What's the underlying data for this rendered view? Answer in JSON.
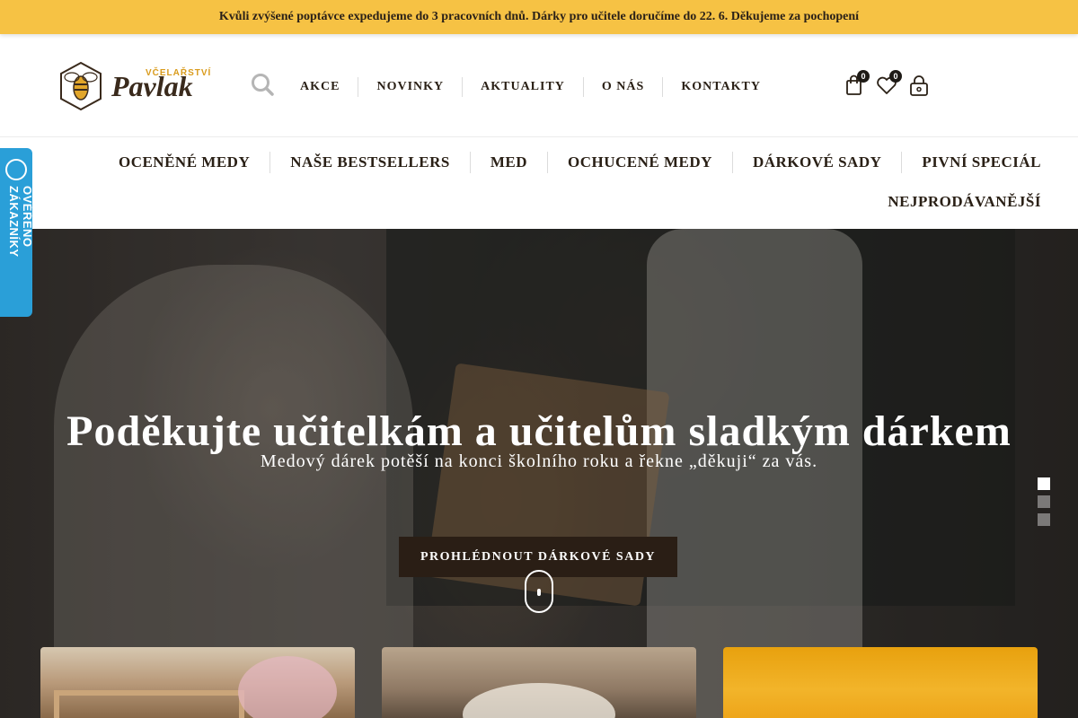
{
  "announcement": "Kvůli zvýšené poptávce expedujeme do 3 pracovních dnů. Dárky pro učitele doručíme do 22. 6. Děkujeme za pochopení",
  "logo": {
    "subtitle": "VČELAŘSTVÍ",
    "name": "Pavlak"
  },
  "main_nav": [
    "AKCE",
    "NOVINKY",
    "AKTUALITY",
    "O NÁS",
    "KONTAKTY"
  ],
  "header_icons": {
    "cart_count": "0",
    "wishlist_count": "0"
  },
  "category_nav": {
    "row1": [
      " OCENĚNÉ MEDY",
      "NAŠE BESTSELLERS",
      "MED",
      "OCHUCENÉ MEDY",
      "DÁRKOVÉ SADY",
      "PIVNÍ SPECIÁL"
    ],
    "row2": [
      "NEJPRODÁVANĚJŠÍ"
    ]
  },
  "verified_badge": "OVĚŘENO ZÁKAZNÍKY",
  "hero": {
    "title": "Poděkujte učitelkám a učitelům sladkým dárkem",
    "subtitle": "Medový dárek potěší na konci školního roku a řekne „děkuji“ za vás. ",
    "button": "PROHLÉDNOUT DÁRKOVÉ SADY",
    "slide_count": 3,
    "active_slide": 1
  },
  "colors": {
    "topbar": "#f6c244",
    "verified": "#2a9fd8",
    "hero_button": "#2a1e15",
    "logo_accent": "#d99b1c"
  }
}
